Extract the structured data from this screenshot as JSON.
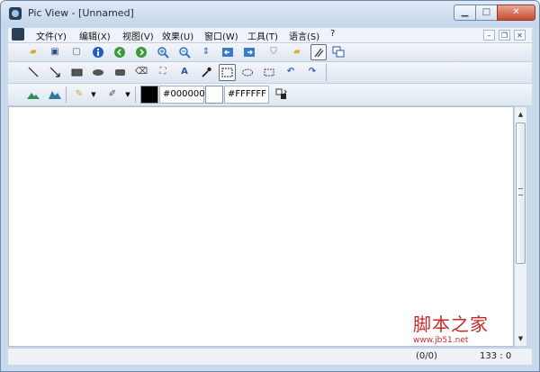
{
  "window": {
    "title": "Pic View - [Unnamed]"
  },
  "menu": {
    "items": [
      "文件(Y)",
      "编辑(X)",
      "视图(V)",
      "效果(U)",
      "窗口(W)",
      "工具(T)",
      "语言(S)",
      "?"
    ]
  },
  "colors": {
    "foreground": "#000000",
    "background": "#FFFFFF"
  },
  "color_fields": {
    "fore_hex": "#000000",
    "back_hex": "#FFFFFF"
  },
  "status": {
    "position": "(0/0)",
    "cursor": "133 : 0"
  },
  "watermark": {
    "line1": "脚本之家",
    "line2": "www.jb51.net"
  }
}
